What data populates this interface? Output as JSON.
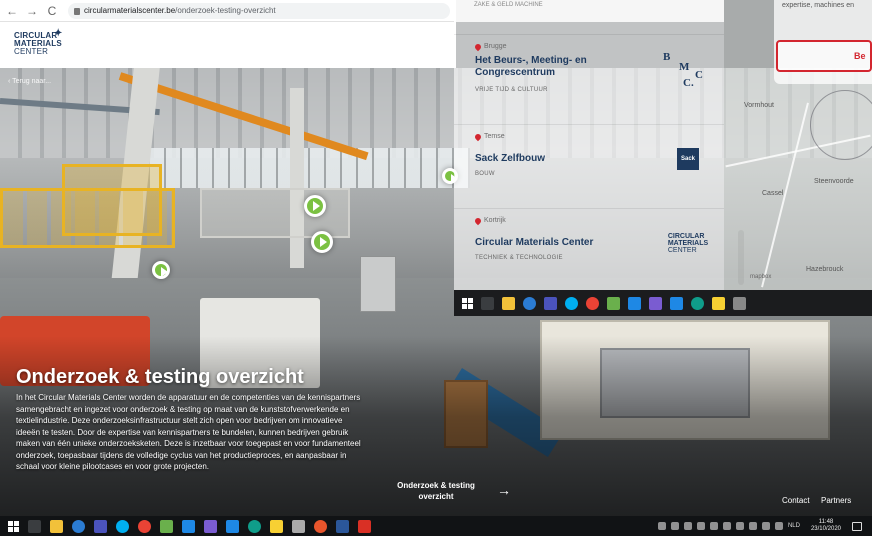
{
  "browser": {
    "back": "←",
    "forward": "→",
    "reload": "C",
    "url_host": "circularmaterialscenter.be",
    "url_path": "/onderzoek-testing-overzicht"
  },
  "header": {
    "logo_line1": "CIRCULAR",
    "logo_line2": "MATERIALS",
    "logo_line3": "CENTER",
    "back_link": "‹ Terug naar..."
  },
  "hero": {
    "title": "Onderzoek & testing overzicht",
    "body": "In het Circular Materials Center worden de apparatuur en de competenties van de kennispartners samengebracht en ingezet voor onderzoek & testing op maat van de kunststofverwerkende en textielindustrie. Deze onderzoeksinfrastructuur stelt zich open voor bedrijven om innovatieve ideeën te testen. Door de expertise van kennispartners te bundelen, kunnen bedrijven gebruik maken van één unieke onderzoeksketen. Deze is inzetbaar voor toegepast en voor fundamenteel onderzoek, toepasbaar tijdens de volledige cyclus van het productieproces, en aanpasbaar in schaal voor kleine pilootcases en voor grote projecten.",
    "tour_label": "Onderzoek & testing overzicht",
    "tour_arrow": "→"
  },
  "footer": {
    "contact": "Contact",
    "partners": "Partners"
  },
  "overlay": {
    "top_text": "ZAKE & GELD MACHINE",
    "entries": [
      {
        "location": "Brugge",
        "name": "Het Beurs-, Meeting- en Congrescentrum",
        "category": "VRIJE TIJD & CULTUUR",
        "logo_b": "B",
        "logo_m": "M",
        "logo_c1": "C",
        "logo_c2": "C."
      },
      {
        "location": "Temse",
        "name": "Sack Zelfbouw",
        "category": "BOUW",
        "logo_text": "Sack"
      },
      {
        "location": "Kortrijk",
        "name": "Circular Materials Center",
        "category": "TECHNIEK & TECHNOLOGIE",
        "logo_l1": "CIRCULAR",
        "logo_l2": "MATERIALS",
        "logo_l3": "CENTER"
      }
    ],
    "map": {
      "info_text": "expertise, machines en",
      "button_label": "Be",
      "towns": [
        "Vormhout",
        "Steenvoorde",
        "Cassel",
        "Hazebrouck"
      ],
      "attribution": "mapbox"
    }
  },
  "taskbar": {
    "lang": "NLD",
    "time": "11:48",
    "date": "23/10/2020"
  }
}
